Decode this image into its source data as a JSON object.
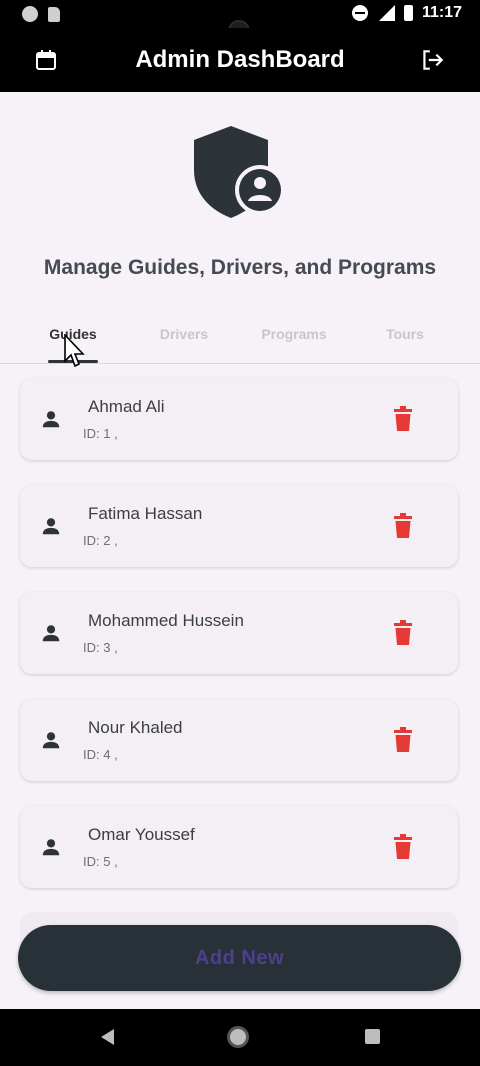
{
  "status_bar": {
    "time": "11:17",
    "icons": [
      "notification-dot-icon",
      "sd-card-icon",
      "do-not-disturb-icon",
      "signal-icon",
      "battery-icon"
    ]
  },
  "app_bar": {
    "title": "Admin DashBoard",
    "left_icon": "calendar-icon",
    "right_icon": "logout-icon"
  },
  "hero": {
    "icon": "admin-shield-icon",
    "title": "Manage Guides, Drivers, and Programs"
  },
  "tabs": [
    {
      "label": "Guides",
      "active": true
    },
    {
      "label": "Drivers",
      "active": false
    },
    {
      "label": "Programs",
      "active": false
    },
    {
      "label": "Tours",
      "active": false
    }
  ],
  "guides": [
    {
      "name": "Ahmad Ali",
      "id_text": "ID: 1 ,"
    },
    {
      "name": "Fatima Hassan",
      "id_text": "ID: 2 ,"
    },
    {
      "name": "Mohammed Hussein",
      "id_text": "ID: 3 ,"
    },
    {
      "name": "Nour Khaled",
      "id_text": "ID: 4 ,"
    },
    {
      "name": "Omar Youssef",
      "id_text": "ID: 5 ,"
    }
  ],
  "add_button": {
    "label": "Add New"
  },
  "colors": {
    "app_bar": "#000000",
    "background": "#f7f2f8",
    "accent": "#283137",
    "delete": "#e53935",
    "button_text": "#4e3f8f"
  },
  "nav_bar": {
    "icons": [
      "back-icon",
      "home-icon",
      "recents-icon"
    ]
  }
}
